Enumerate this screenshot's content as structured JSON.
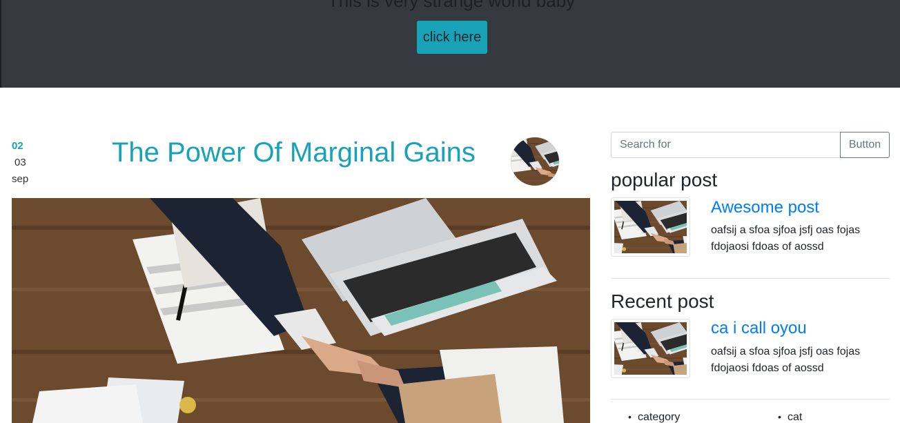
{
  "hero": {
    "title": "This is very strange world baby",
    "button_label": "click here"
  },
  "post": {
    "date_day1": "02",
    "date_day2": "03",
    "date_month": "sep",
    "title": "The Power Of Marginal Gains"
  },
  "sidebar": {
    "search_placeholder": "Search for",
    "search_button": "Button",
    "popular_heading": "popular post",
    "popular_title": "Awesome post",
    "popular_text": "oafsij a sfoa sjfoa jsfj oas fojas fdojaosi fdoas of aossd",
    "recent_heading": "Recent post",
    "recent_title": "ca i call oyou",
    "recent_text": "oafsij a sfoa sjfoa jsfj oas fojas fdojaosi fdoas of aossd",
    "categories": [
      "category",
      "cat"
    ]
  },
  "colors": {
    "hero_bg": "#343a40",
    "accent": "#17a2b8",
    "link": "#007bff"
  }
}
